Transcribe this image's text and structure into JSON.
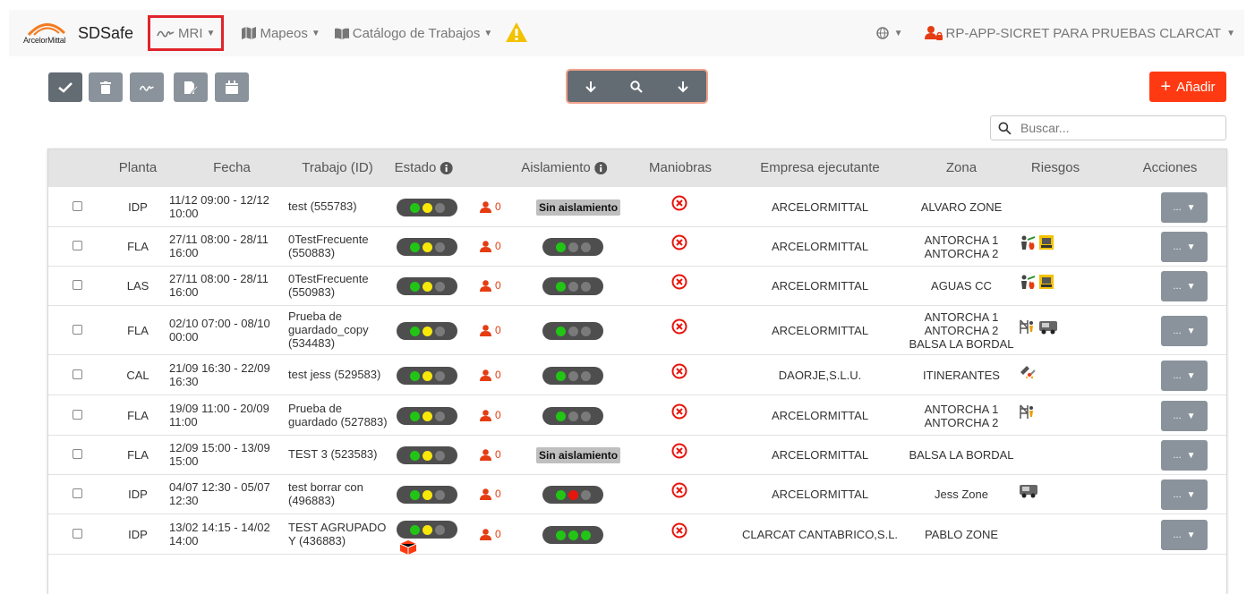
{
  "nav": {
    "brand_logo_text": "ArcelorMittal",
    "brand_name": "SDSafe",
    "mri_label": "MRI",
    "mapeos_label": "Mapeos",
    "catalogo_label": "Catálogo de Trabajos",
    "user_label": "RP-APP-SICRET PARA PRUEBAS CLARCAT"
  },
  "toolbar": {
    "add_label": "Añadir",
    "search_placeholder": "Buscar..."
  },
  "columns": {
    "planta": "Planta",
    "fecha": "Fecha",
    "trabajo": "Trabajo (ID)",
    "estado": "Estado",
    "aislamiento": "Aislamiento",
    "maniobras": "Maniobras",
    "empresa": "Empresa ejecutante",
    "zona": "Zona",
    "riesgos": "Riesgos",
    "acciones": "Acciones"
  },
  "colors": {
    "accent_red": "#ff3a12",
    "green": "#22c416",
    "yellow": "#f7e80a",
    "red": "#e8150c",
    "gray": "#777777"
  },
  "rows": [
    {
      "planta": "IDP",
      "fecha1": "11/12 09:00 - 12/12",
      "fecha2": "10:00",
      "trabajo1": "test (555783)",
      "trabajo2": "",
      "trabajo3": "",
      "estado": [
        "green",
        "yellow",
        "gray"
      ],
      "personas": "0",
      "aislamiento": "Sin aislamiento",
      "empresa": "ARCELORMITTAL",
      "zona1": "ALVARO ZONE",
      "zona2": "",
      "zona3": "",
      "riesgos": [],
      "acciones": "..."
    },
    {
      "planta": "FLA",
      "fecha1": "27/11 08:00 - 28/11",
      "fecha2": "16:00",
      "trabajo1": "0TestFrecuente",
      "trabajo2": "(550883)",
      "trabajo3": "",
      "estado": [
        "green",
        "yellow",
        "gray"
      ],
      "personas": "0",
      "aislamiento": [
        "green",
        "gray",
        "gray"
      ],
      "empresa": "ARCELORMITTAL",
      "zona1": "ANTORCHA 1",
      "zona2": "ANTORCHA 2",
      "zona3": "",
      "riesgos": [
        "flame-person-icon",
        "machine-icon"
      ],
      "acciones": "..."
    },
    {
      "planta": "LAS",
      "fecha1": "27/11 08:00 - 28/11",
      "fecha2": "16:00",
      "trabajo1": "0TestFrecuente",
      "trabajo2": "(550983)",
      "trabajo3": "",
      "estado": [
        "green",
        "yellow",
        "gray"
      ],
      "personas": "0",
      "aislamiento": [
        "green",
        "gray",
        "gray"
      ],
      "empresa": "ARCELORMITTAL",
      "zona1": "AGUAS CC",
      "zona2": "",
      "zona3": "",
      "riesgos": [
        "flame-person-icon",
        "machine-icon"
      ],
      "acciones": "..."
    },
    {
      "planta": "FLA",
      "fecha1": "02/10 07:00 - 08/10",
      "fecha2": "00:00",
      "trabajo1": "Prueba de",
      "trabajo2": "guardado_copy",
      "trabajo3": "(534483)",
      "estado": [
        "green",
        "yellow",
        "gray"
      ],
      "personas": "0",
      "aislamiento": [
        "green",
        "gray",
        "gray"
      ],
      "empresa": "ARCELORMITTAL",
      "zona1": "ANTORCHA 1",
      "zona2": "ANTORCHA 2",
      "zona3": "BALSA LA BORDAL",
      "riesgos": [
        "scaffold-icon",
        "vehicle-icon"
      ],
      "acciones": "..."
    },
    {
      "planta": "CAL",
      "fecha1": "21/09 16:30 - 22/09",
      "fecha2": "16:30",
      "trabajo1": "test jess (529583)",
      "trabajo2": "",
      "trabajo3": "",
      "estado": [
        "green",
        "yellow",
        "gray"
      ],
      "personas": "0",
      "aislamiento": [
        "green",
        "gray",
        "gray"
      ],
      "empresa": "DAORJE,S.L.U.",
      "zona1": "ITINERANTES",
      "zona2": "",
      "zona3": "",
      "riesgos": [
        "welding-icon"
      ],
      "acciones": "..."
    },
    {
      "planta": "FLA",
      "fecha1": "19/09 11:00 - 20/09",
      "fecha2": "11:00",
      "trabajo1": "Prueba de",
      "trabajo2": "guardado (527883)",
      "trabajo3": "",
      "estado": [
        "green",
        "yellow",
        "gray"
      ],
      "personas": "0",
      "aislamiento": [
        "green",
        "gray",
        "gray"
      ],
      "empresa": "ARCELORMITTAL",
      "zona1": "ANTORCHA 1",
      "zona2": "ANTORCHA 2",
      "zona3": "",
      "riesgos": [
        "scaffold-icon"
      ],
      "acciones": "..."
    },
    {
      "planta": "FLA",
      "fecha1": "12/09 15:00 - 13/09",
      "fecha2": "15:00",
      "trabajo1": "TEST 3 (523583)",
      "trabajo2": "",
      "trabajo3": "",
      "estado": [
        "green",
        "yellow",
        "gray"
      ],
      "personas": "0",
      "aislamiento": "Sin aislamiento",
      "empresa": "ARCELORMITTAL",
      "zona1": "BALSA LA BORDAL",
      "zona2": "",
      "zona3": "",
      "riesgos": [],
      "acciones": "..."
    },
    {
      "planta": "IDP",
      "fecha1": "04/07 12:30 - 05/07",
      "fecha2": "12:30",
      "trabajo1": "test borrar con",
      "trabajo2": "(496883)",
      "trabajo3": "",
      "estado": [
        "green",
        "yellow",
        "gray"
      ],
      "personas": "0",
      "aislamiento": [
        "green",
        "red",
        "gray"
      ],
      "empresa": "ARCELORMITTAL",
      "zona1": "Jess Zone",
      "zona2": "",
      "zona3": "",
      "riesgos": [
        "vehicle-icon"
      ],
      "acciones": "..."
    },
    {
      "planta": "IDP",
      "fecha1": "13/02 14:15 - 14/02",
      "fecha2": "14:00",
      "trabajo1": "TEST AGRUPADO",
      "trabajo2": "Y (436883)",
      "trabajo3": "",
      "estado": [
        "green",
        "yellow",
        "gray"
      ],
      "estado_extra": "cube-icon",
      "personas": "0",
      "aislamiento": [
        "green",
        "green",
        "green"
      ],
      "empresa": "CLARCAT CANTABRICO,S.L.",
      "zona1": "PABLO ZONE",
      "zona2": "",
      "zona3": "",
      "riesgos": [],
      "acciones": "..."
    }
  ]
}
